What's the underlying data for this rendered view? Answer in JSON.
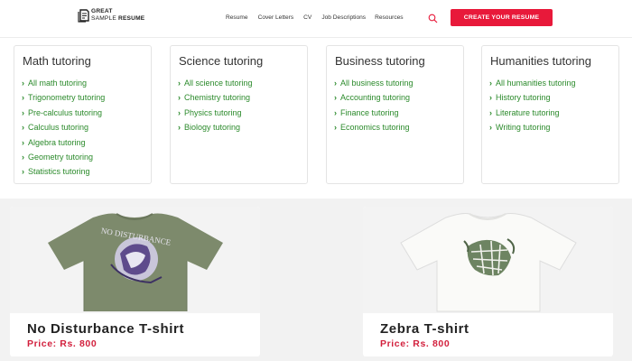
{
  "header": {
    "logo_line1": "GREAT",
    "logo_line2_a": "SAMPLE ",
    "logo_line2_b": "RESUME",
    "nav": [
      "Resume",
      "Cover Letters",
      "CV",
      "Job Descriptions",
      "Resources"
    ],
    "search_icon": "search-icon",
    "cta_label": "CREATE YOUR RESUME",
    "accent": "#e8193a"
  },
  "tutoring": {
    "link_color": "#2b8a2b",
    "cards": [
      {
        "title": "Math tutoring",
        "items": [
          "All math tutoring",
          "Trigonometry tutoring",
          "Pre-calculus tutoring",
          "Calculus tutoring",
          "Algebra tutoring",
          "Geometry tutoring",
          "Statistics tutoring"
        ]
      },
      {
        "title": "Science tutoring",
        "items": [
          "All science tutoring",
          "Chemistry tutoring",
          "Physics tutoring",
          "Biology tutoring"
        ]
      },
      {
        "title": "Business tutoring",
        "items": [
          "All business tutoring",
          "Accounting tutoring",
          "Finance tutoring",
          "Economics tutoring"
        ]
      },
      {
        "title": "Humanities tutoring",
        "items": [
          "All humanities tutoring",
          "History tutoring",
          "Literature tutoring",
          "Writing tutoring"
        ]
      }
    ]
  },
  "products": [
    {
      "name": "No Disturbance T-shirt",
      "price": "Price: Rs. 800",
      "print_text": "NO DISTURBANCE",
      "shirt_color": "#7d8a6c"
    },
    {
      "name": "Zebra T-shirt",
      "price": "Price: Rs. 800",
      "shirt_color": "#f7f7f5"
    }
  ]
}
